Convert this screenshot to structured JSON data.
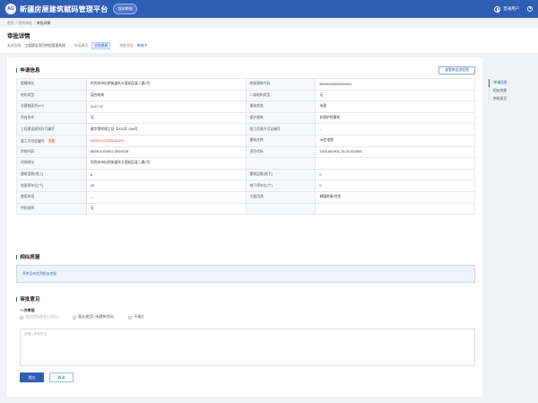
{
  "header": {
    "logo_text": "AG",
    "app_title": "新疆房屋建筑赋码管理平台",
    "my_approval": "我的审批",
    "user_name": "普通用户"
  },
  "breadcrumb": [
    "首页",
    "/",
    "我的审批",
    "/",
    "审批详情"
  ],
  "page": {
    "title": "审批详情",
    "source_system_label": "来源系统:",
    "source_system_value": "工程建设项目审批管理系统",
    "apply_type_label": "申请事项:",
    "apply_type_value": "信息更新",
    "status_label": "审批状态:",
    "status_value": "审核中"
  },
  "sections": {
    "apply_info": "申请信息",
    "related_houses": "相似房屋",
    "opinion": "审批意见"
  },
  "flow_button": "查看审批流程图",
  "info_rows": [
    [
      "楼幢地址",
      "阿克苏市红桥街道托卡酒花区延二路2号",
      "房屋建筑代码",
      "65290103002000021"
    ],
    [
      "结构类型",
      "混合结构",
      "二级结构类型",
      "无"
    ],
    [
      "总建筑面积(m²)",
      "3147.76",
      "建造状态",
      "未建"
    ],
    [
      "所有车库",
      "无",
      "保护建筑",
      "非保护性建筑"
    ],
    [
      "工程建设规划许可编号",
      "建字第阿规工证【2022】056号",
      "竣工验收许可证编号",
      "--"
    ],
    [
      "施工许可证编号",
      "652901202208180201",
      "建筑名称",
      "3#住宅楼"
    ],
    [
      "宗地代码",
      "652901003001 GB00028",
      "项目代码",
      "2203-652901-75-03-002885"
    ],
    [
      "详细地址",
      "阿克苏市红桥街道托卡酒花区延二路2号",
      "",
      ""
    ],
    [
      "建筑层数(地上)",
      "6",
      "建筑层数(地下)",
      "0"
    ],
    [
      "地面停车位(个)",
      "20",
      "地下停车位(个)",
      "0"
    ],
    [
      "使用年限",
      "--",
      "主要用途",
      "城镇房屋/住宅"
    ],
    [
      "特别说明",
      "无",
      "",
      ""
    ]
  ],
  "changed_tag": "变更",
  "alert_text": "系统没有找到相似房屋",
  "opinion": {
    "round_label": "一次审批",
    "options": [
      "通过(提请复核后通过)",
      "通过(使用已有建筑代码)",
      "不通过"
    ],
    "placeholder": "请输入审批意见",
    "submit": "提交",
    "cancel": "取消"
  },
  "anchor_nav": [
    "申请信息",
    "相似房屋",
    "审批意见"
  ],
  "colors": {
    "brand": "#2f5fb5",
    "danger": "#e54545",
    "alert_bg": "#eef4ff"
  }
}
